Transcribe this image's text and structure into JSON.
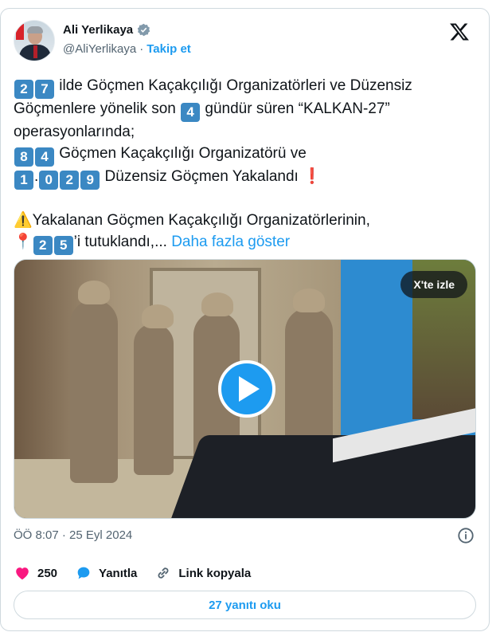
{
  "author": {
    "display_name": "Ali Yerlikaya",
    "handle": "@AliYerlikaya",
    "follow_label": "Takip et",
    "separator": "·"
  },
  "tweet": {
    "line1_num_a": "2",
    "line1_num_b": "7",
    "line1_text": " ilde Göçmen Kaçakçılığı Organizatörleri ve Düzensiz",
    "line2_pre": "Göçmenlere yönelik son ",
    "line2_num": "4",
    "line2_post": " gündür süren “KALKAN-27”",
    "line3": "operasyonlarında;",
    "line4_num_a": "8",
    "line4_num_b": "4",
    "line4_text": " Göçmen Kaçakçılığı Organizatörü ve",
    "line5_num_a": "1",
    "line5_sep": ".",
    "line5_num_b": "0",
    "line5_num_c": "2",
    "line5_num_d": "9",
    "line5_text": " Düzensiz Göçmen Yakalandı ",
    "line5_mark": "❗",
    "line6_icon": "⚠️",
    "line6_text": "Yakalanan Göçmen Kaçakçılığı Organizatörlerinin,",
    "line7_icon": "📍",
    "line7_num_a": "2",
    "line7_num_b": "5",
    "line7_text": "’i tutuklandı,... ",
    "show_more": "Daha fazla göster"
  },
  "media": {
    "watch_on_x": "X'te izle",
    "play_icon": "play-icon"
  },
  "timestamp": "ÖÖ 8:07 · 25 Eyl 2024",
  "actions": {
    "like_count": "250",
    "reply_label": "Yanıtla",
    "copy_link_label": "Link kopyala"
  },
  "read_replies_label": "27 yanıtı oku",
  "colors": {
    "accent": "#1d9bf0",
    "like": "#f91880",
    "keycap": "#3b88c3",
    "muted": "#536471"
  }
}
